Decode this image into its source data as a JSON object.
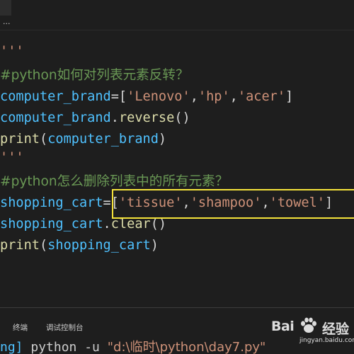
{
  "breadcrumb": {
    "text": "..."
  },
  "editor": {
    "lines": {
      "l1": {
        "doc": "'''"
      },
      "l2": {
        "comment": "#python如何对列表元素反转？"
      },
      "l3": {
        "var": "computer_brand",
        "eq": "=[",
        "s1": "'Lenovo'",
        "c1": ",",
        "s2": "'hp'",
        "c2": ",",
        "s3": "'acer'",
        "end": "]"
      },
      "l4": {
        "var": "computer_brand",
        "dot": ".",
        "fn": "reverse",
        "paren": "()"
      },
      "l5": {
        "fn": "print",
        "open": "(",
        "var": "computer_brand",
        "close": ")"
      },
      "l6": {
        "doc": "'''"
      },
      "l7": {
        "comment": "#python怎么删除列表中的所有元素？"
      },
      "l8": {
        "var": "shopping_cart",
        "eq": "=[",
        "s1": "'tissue'",
        "c1": ",",
        "s2": "'shampoo'",
        "c2": ",",
        "s3": "'towel'",
        "end": "]"
      },
      "l9": {
        "var": "shopping_cart",
        "dot": ".",
        "fn": "clear",
        "paren": "()"
      },
      "l10": {
        "fn": "print",
        "open": "(",
        "var": "shopping_cart",
        "close": ")"
      }
    }
  },
  "panel": {
    "tabs": [
      "终端",
      "调试控制台"
    ],
    "terminal": {
      "prompt": "ng]",
      "cmd": " python -u ",
      "path": "\"d:\\临时\\python\\day7.py\""
    }
  },
  "watermark": {
    "brand": "Bai",
    "cn": "经验",
    "url": "jingyan.baidu.com"
  },
  "colors": {
    "background": "#1e1e1e",
    "string": "#ce9178",
    "comment": "#6a9955",
    "variable": "#4fc1ff",
    "function": "#dcdcaa",
    "highlight": "#f5e33a"
  }
}
